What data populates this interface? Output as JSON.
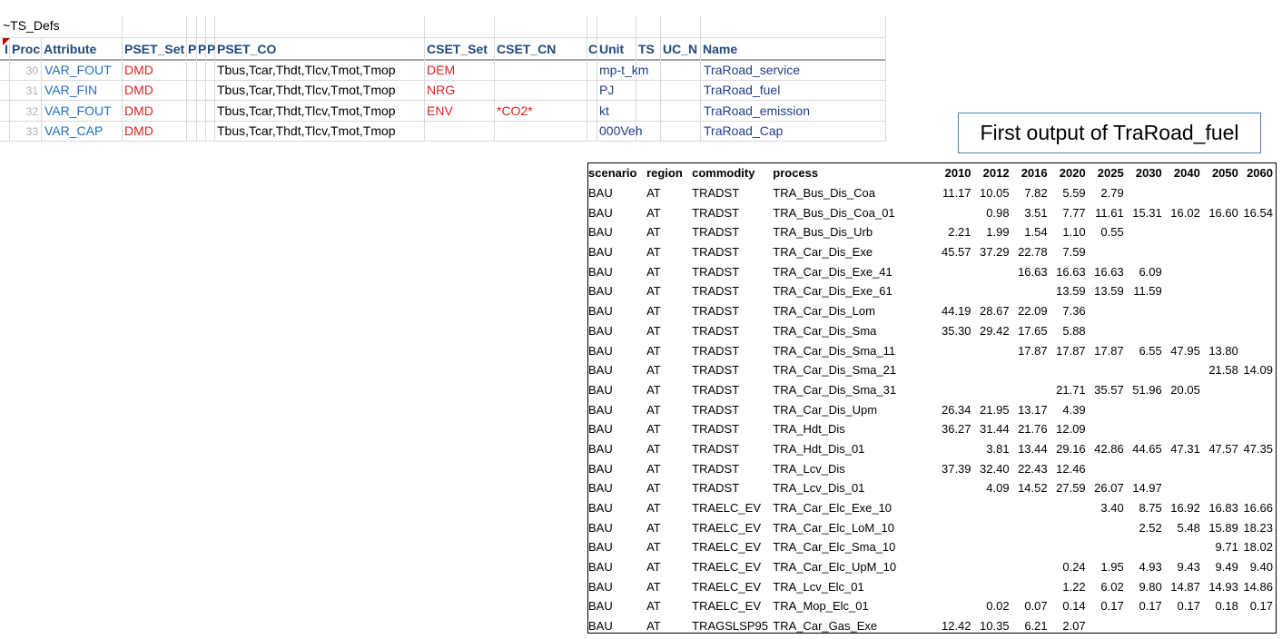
{
  "sheet": {
    "title": "~TS_Defs",
    "headers": {
      "i": "I",
      "proc": "Proc",
      "attribute": "Attribute",
      "pset_set": "PSET_Set",
      "p1": "P",
      "p2": "P",
      "p3": "P",
      "pset_co": "PSET_CO",
      "cset_set": "CSET_Set",
      "cset_cn": "CSET_CN",
      "c": "C",
      "unit": "Unit",
      "ts": "TS",
      "uc_n": "UC_N",
      "name": "Name"
    },
    "rows": [
      {
        "num": "30",
        "attribute": "VAR_FOUT",
        "pset_set": "DMD",
        "pset_co": "Tbus,Tcar,Thdt,Tlcv,Tmot,Tmop",
        "cset_set": "DEM",
        "cset_cn": "",
        "unit": "mp-t_km",
        "name": "TraRoad_service"
      },
      {
        "num": "31",
        "attribute": "VAR_FIN",
        "pset_set": "DMD",
        "pset_co": "Tbus,Tcar,Thdt,Tlcv,Tmot,Tmop",
        "cset_set": "NRG",
        "cset_cn": "",
        "unit": "PJ",
        "name": "TraRoad_fuel"
      },
      {
        "num": "32",
        "attribute": "VAR_FOUT",
        "pset_set": "DMD",
        "pset_co": "Tbus,Tcar,Thdt,Tlcv,Tmot,Tmop",
        "cset_set": "ENV",
        "cset_cn": "*CO2*",
        "unit": "kt",
        "name": "TraRoad_emission"
      },
      {
        "num": "33",
        "attribute": "VAR_CAP",
        "pset_set": "DMD",
        "pset_co": "Tbus,Tcar,Thdt,Tlcv,Tmot,Tmop",
        "cset_set": "",
        "cset_cn": "",
        "unit": "000Veh",
        "name": "TraRoad_Cap"
      }
    ]
  },
  "callout": "First output of TraRoad_fuel",
  "output": {
    "columns": [
      "scenario",
      "region",
      "commodity",
      "process",
      "2010",
      "2012",
      "2016",
      "2020",
      "2025",
      "2030",
      "2040",
      "2050",
      "2060"
    ],
    "rows": [
      [
        "BAU",
        "AT",
        "TRADST",
        "TRA_Bus_Dis_Coa",
        "11.17",
        "10.05",
        "7.82",
        "5.59",
        "2.79",
        "",
        "",
        "",
        ""
      ],
      [
        "BAU",
        "AT",
        "TRADST",
        "TRA_Bus_Dis_Coa_01",
        "",
        "0.98",
        "3.51",
        "7.77",
        "11.61",
        "15.31",
        "16.02",
        "16.60",
        "16.54"
      ],
      [
        "BAU",
        "AT",
        "TRADST",
        "TRA_Bus_Dis_Urb",
        "2.21",
        "1.99",
        "1.54",
        "1.10",
        "0.55",
        "",
        "",
        "",
        ""
      ],
      [
        "BAU",
        "AT",
        "TRADST",
        "TRA_Car_Dis_Exe",
        "45.57",
        "37.29",
        "22.78",
        "7.59",
        "",
        "",
        "",
        "",
        ""
      ],
      [
        "BAU",
        "AT",
        "TRADST",
        "TRA_Car_Dis_Exe_41",
        "",
        "",
        "16.63",
        "16.63",
        "16.63",
        "6.09",
        "",
        "",
        ""
      ],
      [
        "BAU",
        "AT",
        "TRADST",
        "TRA_Car_Dis_Exe_61",
        "",
        "",
        "",
        "13.59",
        "13.59",
        "11.59",
        "",
        "",
        ""
      ],
      [
        "BAU",
        "AT",
        "TRADST",
        "TRA_Car_Dis_Lom",
        "44.19",
        "28.67",
        "22.09",
        "7.36",
        "",
        "",
        "",
        "",
        ""
      ],
      [
        "BAU",
        "AT",
        "TRADST",
        "TRA_Car_Dis_Sma",
        "35.30",
        "29.42",
        "17.65",
        "5.88",
        "",
        "",
        "",
        "",
        ""
      ],
      [
        "BAU",
        "AT",
        "TRADST",
        "TRA_Car_Dis_Sma_11",
        "",
        "",
        "17.87",
        "17.87",
        "17.87",
        "6.55",
        "47.95",
        "13.80",
        ""
      ],
      [
        "BAU",
        "AT",
        "TRADST",
        "TRA_Car_Dis_Sma_21",
        "",
        "",
        "",
        "",
        "",
        "",
        "",
        "21.58",
        "14.09"
      ],
      [
        "BAU",
        "AT",
        "TRADST",
        "TRA_Car_Dis_Sma_31",
        "",
        "",
        "",
        "21.71",
        "35.57",
        "51.96",
        "20.05",
        "",
        ""
      ],
      [
        "BAU",
        "AT",
        "TRADST",
        "TRA_Car_Dis_Upm",
        "26.34",
        "21.95",
        "13.17",
        "4.39",
        "",
        "",
        "",
        "",
        ""
      ],
      [
        "BAU",
        "AT",
        "TRADST",
        "TRA_Hdt_Dis",
        "36.27",
        "31.44",
        "21.76",
        "12.09",
        "",
        "",
        "",
        "",
        ""
      ],
      [
        "BAU",
        "AT",
        "TRADST",
        "TRA_Hdt_Dis_01",
        "",
        "3.81",
        "13.44",
        "29.16",
        "42.86",
        "44.65",
        "47.31",
        "47.57",
        "47.35"
      ],
      [
        "BAU",
        "AT",
        "TRADST",
        "TRA_Lcv_Dis",
        "37.39",
        "32.40",
        "22.43",
        "12.46",
        "",
        "",
        "",
        "",
        ""
      ],
      [
        "BAU",
        "AT",
        "TRADST",
        "TRA_Lcv_Dis_01",
        "",
        "4.09",
        "14.52",
        "27.59",
        "26.07",
        "14.97",
        "",
        "",
        ""
      ],
      [
        "BAU",
        "AT",
        "TRAELC_EV",
        "TRA_Car_Elc_Exe_10",
        "",
        "",
        "",
        "",
        "3.40",
        "8.75",
        "16.92",
        "16.83",
        "16.66"
      ],
      [
        "BAU",
        "AT",
        "TRAELC_EV",
        "TRA_Car_Elc_LoM_10",
        "",
        "",
        "",
        "",
        "",
        "2.52",
        "5.48",
        "15.89",
        "18.23"
      ],
      [
        "BAU",
        "AT",
        "TRAELC_EV",
        "TRA_Car_Elc_Sma_10",
        "",
        "",
        "",
        "",
        "",
        "",
        "",
        "9.71",
        "18.02"
      ],
      [
        "BAU",
        "AT",
        "TRAELC_EV",
        "TRA_Car_Elc_UpM_10",
        "",
        "",
        "",
        "0.24",
        "1.95",
        "4.93",
        "9.43",
        "9.49",
        "9.40"
      ],
      [
        "BAU",
        "AT",
        "TRAELC_EV",
        "TRA_Lcv_Elc_01",
        "",
        "",
        "",
        "1.22",
        "6.02",
        "9.80",
        "14.87",
        "14.93",
        "14.86"
      ],
      [
        "BAU",
        "AT",
        "TRAELC_EV",
        "TRA_Mop_Elc_01",
        "",
        "0.02",
        "0.07",
        "0.14",
        "0.17",
        "0.17",
        "0.17",
        "0.18",
        "0.17"
      ],
      [
        "BAU",
        "AT",
        "TRAGSLSP95",
        "TRA_Car_Gas_Exe",
        "12.42",
        "10.35",
        "6.21",
        "2.07",
        "",
        "",
        "",
        "",
        ""
      ]
    ]
  }
}
